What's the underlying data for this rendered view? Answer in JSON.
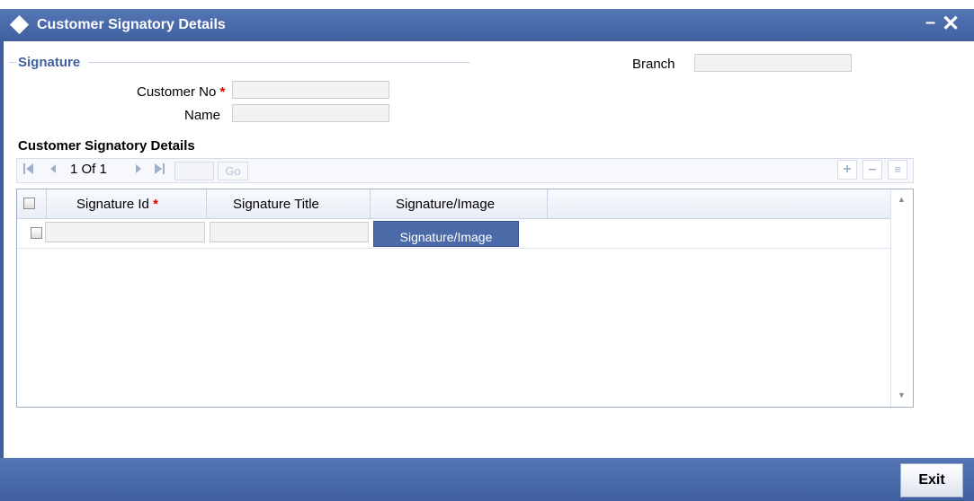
{
  "window": {
    "title": "Customer Signatory Details",
    "minimize_symbol": "–",
    "close_symbol": "✕"
  },
  "signature_section": {
    "legend": "Signature",
    "branch_label": "Branch",
    "branch_value": "",
    "customer_no_label": "Customer No",
    "customer_no_value": "",
    "name_label": "Name",
    "name_value": "",
    "required_mark": "*"
  },
  "details": {
    "section_title": "Customer Signatory Details",
    "pagination": {
      "first_icon": "first-page-icon",
      "prev_icon": "prev-page-icon",
      "page_text": "1 Of 1",
      "next_icon": "next-page-icon",
      "last_icon": "last-page-icon",
      "go_label": "Go",
      "page_input_value": ""
    },
    "toolbar_buttons": [
      "add-row-icon",
      "delete-row-icon",
      "single-view-icon"
    ],
    "columns": [
      {
        "label": "Signature Id",
        "required": true
      },
      {
        "label": "Signature Title",
        "required": false
      },
      {
        "label": "Signature/Image",
        "required": false
      }
    ],
    "rows": [
      {
        "signature_id": "",
        "signature_title": "",
        "image_button_label": "Signature/Image"
      }
    ]
  },
  "footer": {
    "exit_label": "Exit"
  },
  "colors": {
    "brand": "#4a6aa8",
    "legend": "#3f5f9e",
    "required": "#dd0000"
  }
}
